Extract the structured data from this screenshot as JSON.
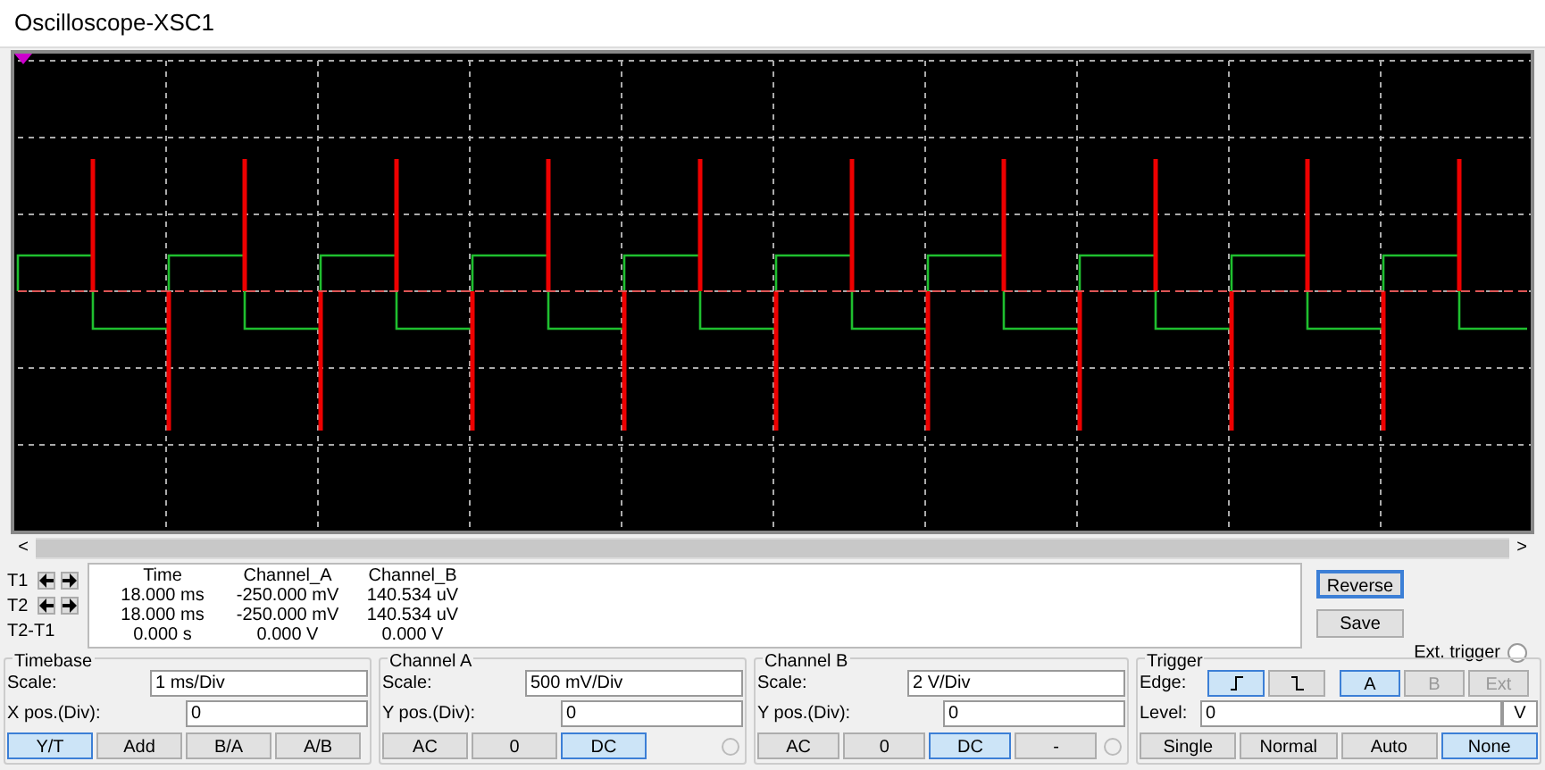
{
  "window": {
    "title": "Oscilloscope-XSC1"
  },
  "readout": {
    "columns": [
      "Time",
      "Channel_A",
      "Channel_B"
    ],
    "rows": [
      {
        "label": "T1",
        "arrows": true,
        "values": [
          "18.000 ms",
          "-250.000 mV",
          "140.534 uV"
        ]
      },
      {
        "label": "T2",
        "arrows": true,
        "values": [
          "18.000 ms",
          "-250.000 mV",
          "140.534 uV"
        ]
      },
      {
        "label": "T2-T1",
        "arrows": false,
        "values": [
          "0.000 s",
          "0.000 V",
          "0.000 V"
        ]
      }
    ]
  },
  "actions": [
    {
      "label": "Reverse",
      "selected": true
    },
    {
      "label": "Save",
      "selected": false
    }
  ],
  "ext_trigger": {
    "label": "Ext. trigger",
    "checked": false
  },
  "timebase": {
    "title": "Timebase",
    "fields": [
      {
        "label": "Scale:",
        "value": "1 ms/Div"
      },
      {
        "label": "X pos.(Div):",
        "value": "0"
      }
    ],
    "modes": [
      {
        "label": "Y/T",
        "selected": true
      },
      {
        "label": "Add",
        "selected": false
      },
      {
        "label": "B/A",
        "selected": false
      },
      {
        "label": "A/B",
        "selected": false
      }
    ]
  },
  "channel_a": {
    "title": "Channel A",
    "fields": [
      {
        "label": "Scale:",
        "value": "500 mV/Div"
      },
      {
        "label": "Y pos.(Div):",
        "value": "0"
      }
    ],
    "coupling": [
      {
        "label": "AC",
        "selected": false
      },
      {
        "label": "0",
        "selected": false
      },
      {
        "label": "DC",
        "selected": true
      }
    ]
  },
  "channel_b": {
    "title": "Channel B",
    "fields": [
      {
        "label": "Scale:",
        "value": "2  V/Div"
      },
      {
        "label": "Y pos.(Div):",
        "value": "0"
      }
    ],
    "coupling": [
      {
        "label": "AC",
        "selected": false
      },
      {
        "label": "0",
        "selected": false
      },
      {
        "label": "DC",
        "selected": true
      },
      {
        "label": "-",
        "selected": false
      }
    ]
  },
  "trigger": {
    "title": "Trigger",
    "edge_label": "Edge:",
    "edges": [
      {
        "kind": "rising",
        "selected": true
      },
      {
        "kind": "falling",
        "selected": false
      }
    ],
    "sources": [
      {
        "label": "A",
        "selected": true,
        "disabled": false
      },
      {
        "label": "B",
        "selected": false,
        "disabled": true
      },
      {
        "label": "Ext",
        "selected": false,
        "disabled": true
      }
    ],
    "level_label": "Level:",
    "level_value": "0",
    "level_unit": "V",
    "modes": [
      {
        "label": "Single",
        "selected": false
      },
      {
        "label": "Normal",
        "selected": false
      },
      {
        "label": "Auto",
        "selected": false
      },
      {
        "label": "None",
        "selected": true
      }
    ]
  },
  "scrollbar": {
    "left": "<",
    "right": ">"
  }
}
